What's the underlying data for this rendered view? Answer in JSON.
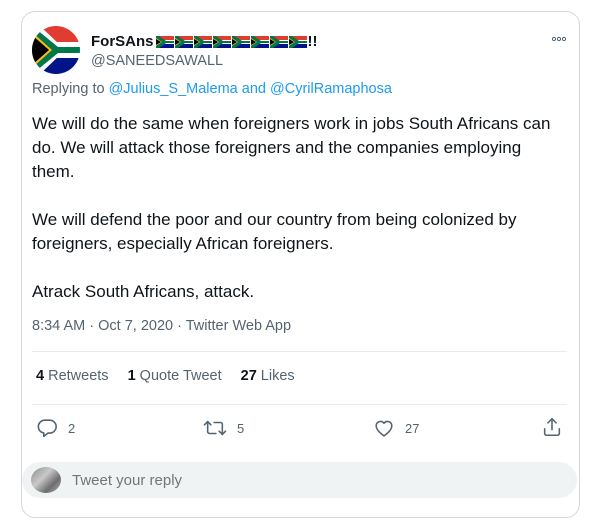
{
  "author": {
    "name": "ForSAns",
    "name_suffix": "!!",
    "flag_count": 8,
    "handle": "@SANEEDSAWALL",
    "avatar_icon": "south-africa-flag-icon"
  },
  "reply_context": {
    "prefix": "Replying to",
    "user1": "@Julius_S_Malema",
    "joiner": "and",
    "user2": "@CyrilRamaphosa"
  },
  "tweet": {
    "paragraphs": [
      "We will do the same when foreigners work in jobs South Africans can do. We will attack those foreigners and the companies employing them.",
      "We will defend the poor and our country from being colonized by foreigners, especially African foreigners.",
      "Atrack South Africans, attack."
    ]
  },
  "meta": {
    "time": "8:34 AM",
    "sep1": "·",
    "date": "Oct 7, 2020",
    "sep2": "·",
    "source": "Twitter Web App"
  },
  "stats": {
    "retweets_count": "4",
    "retweets_label": "Retweets",
    "quotes_count": "1",
    "quotes_label": "Quote Tweet",
    "likes_count": "27",
    "likes_label": "Likes"
  },
  "actions": {
    "reply_count": "2",
    "retweet_count": "5",
    "like_count": "27"
  },
  "reply_box": {
    "placeholder": "Tweet your reply"
  },
  "colors": {
    "accent": "#1d9bf0",
    "muted": "#536471",
    "text": "#0f1419"
  }
}
